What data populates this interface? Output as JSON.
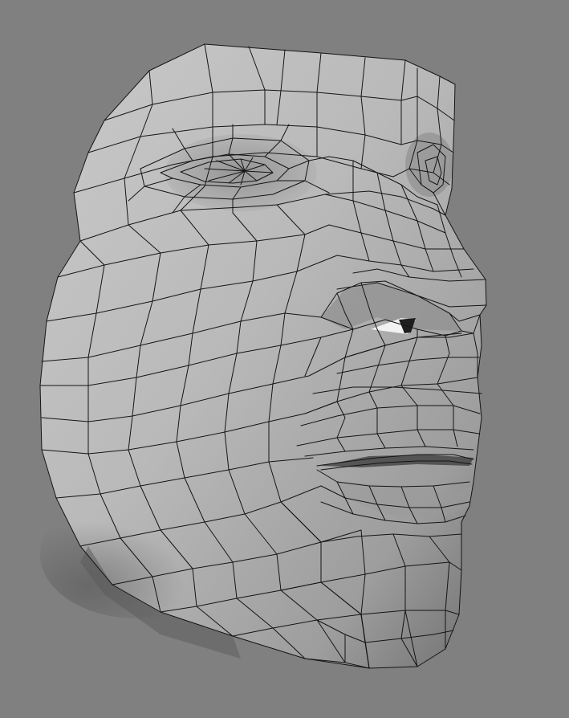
{
  "viewport": {
    "background": "#808080",
    "model": "head-mesh",
    "display_mode": "wireframe-on-shaded",
    "wire_color": "#141414",
    "surface_color": "#b4b4b4"
  }
}
